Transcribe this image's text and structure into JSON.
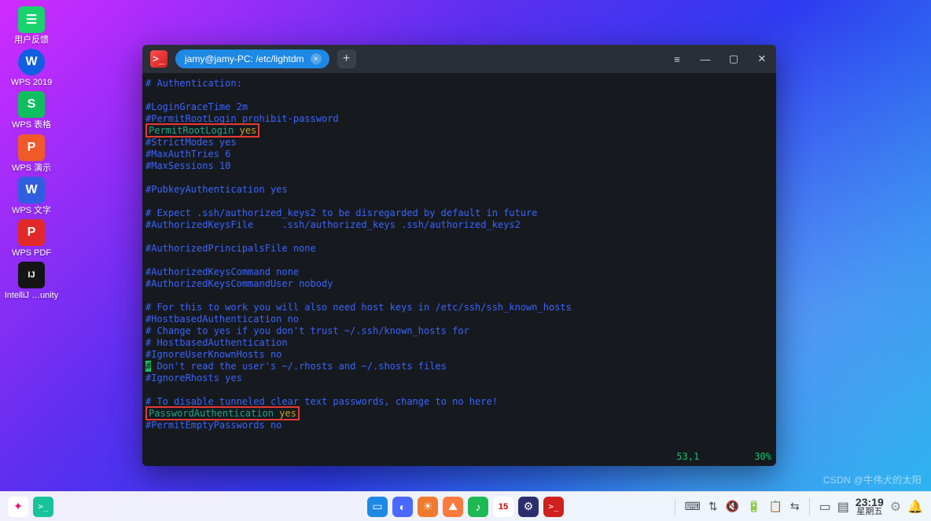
{
  "desktop": {
    "icons": [
      {
        "id": "feedback",
        "glyph": "☰",
        "label": "用户反馈"
      },
      {
        "id": "wps2019",
        "glyph": "W",
        "label": "WPS 2019"
      },
      {
        "id": "wpsbiaoge",
        "glyph": "S",
        "label": "WPS 表格"
      },
      {
        "id": "wpsppt",
        "glyph": "P",
        "label": "WPS 演示"
      },
      {
        "id": "wpswz",
        "glyph": "W",
        "label": "WPS 文字"
      },
      {
        "id": "wpspdf",
        "glyph": "P",
        "label": "WPS PDF"
      },
      {
        "id": "intellij",
        "glyph": "IJ",
        "label": "IntelliJ …unity"
      }
    ]
  },
  "terminal": {
    "app_glyph": ">_",
    "tab_title": "jamy@jamy-PC: /etc/lightdm",
    "tab_close_glyph": "×",
    "new_tab_glyph": "+",
    "menu_glyph": "≡",
    "min_glyph": "—",
    "max_glyph": "▢",
    "close_glyph": "✕",
    "status_pos": "53,1",
    "status_pct": "30%",
    "lines": {
      "l1_comment": "# Authentication:",
      "l2": "#LoginGraceTime 2m",
      "l3": "#PermitRootLogin prohibit-password",
      "l4_k": "PermitRootLogin",
      "l4_v": "yes",
      "l5": "#StrictModes yes",
      "l6": "#MaxAuthTries 6",
      "l7": "#MaxSessions 10",
      "l8": "#PubkeyAuthentication yes",
      "l9a": "# Expect .ssh/authorized_keys2 to be disregarded by default in future",
      "l9b": "#AuthorizedKeysFile     .ssh/authorized_keys .ssh/authorized_keys2",
      "l10": "#AuthorizedPrincipalsFile none",
      "l11": "#AuthorizedKeysCommand none",
      "l12": "#AuthorizedKeysCommandUser nobody",
      "l13a": "# For this to work you will also need host keys in /etc/ssh/ssh_known_hosts",
      "l13b": "#HostbasedAuthentication no",
      "l13c": "# Change to yes if you don't trust ~/.ssh/known_hosts for",
      "l13d": "# HostbasedAuthentication",
      "l13e": "#IgnoreUserKnownHosts no",
      "l13f_pre": "#",
      "l13f": " Don't read the user's ~/.rhosts and ~/.shosts files",
      "l13g": "#IgnoreRhosts yes",
      "l14": "# To disable tunneled clear text passwords, change to no here!",
      "l15_k": "PasswordAuthentication",
      "l15_v": "yes",
      "l16": "#PermitEmptyPasswords no"
    }
  },
  "taskbar": {
    "left": {
      "launcher": "✦",
      "deepin_term": ">_"
    },
    "center": [
      {
        "id": "appstore",
        "glyph": "▭",
        "bg": "#1e88e5"
      },
      {
        "id": "browser",
        "glyph": "◐",
        "bg": "#4a68ff"
      },
      {
        "id": "weather",
        "glyph": "☀",
        "bg": "#f07b2e"
      },
      {
        "id": "photos",
        "glyph": "⛰",
        "bg": "#ff7a3d"
      },
      {
        "id": "music",
        "glyph": "♪",
        "bg": "#1db954"
      },
      {
        "id": "calendar",
        "glyph": "15",
        "bg": "#ffffff"
      },
      {
        "id": "settings",
        "glyph": "⚙",
        "bg": "#2c2f6f"
      },
      {
        "id": "terminal",
        "glyph": ">_",
        "bg": "#d02020"
      }
    ],
    "tray": {
      "keyboard": "⌨",
      "usb": "⇅",
      "volume": "🔇",
      "battery": "🔋",
      "clipboard": "📋",
      "network": "⇆",
      "desktop": "▭",
      "notifs": "▤"
    },
    "clock": {
      "time": "23:19",
      "date": "星期五"
    },
    "extra": {
      "gear": "⚙",
      "bell": "🔔"
    }
  },
  "watermark": "CSDN @牛伟犬的太阳"
}
